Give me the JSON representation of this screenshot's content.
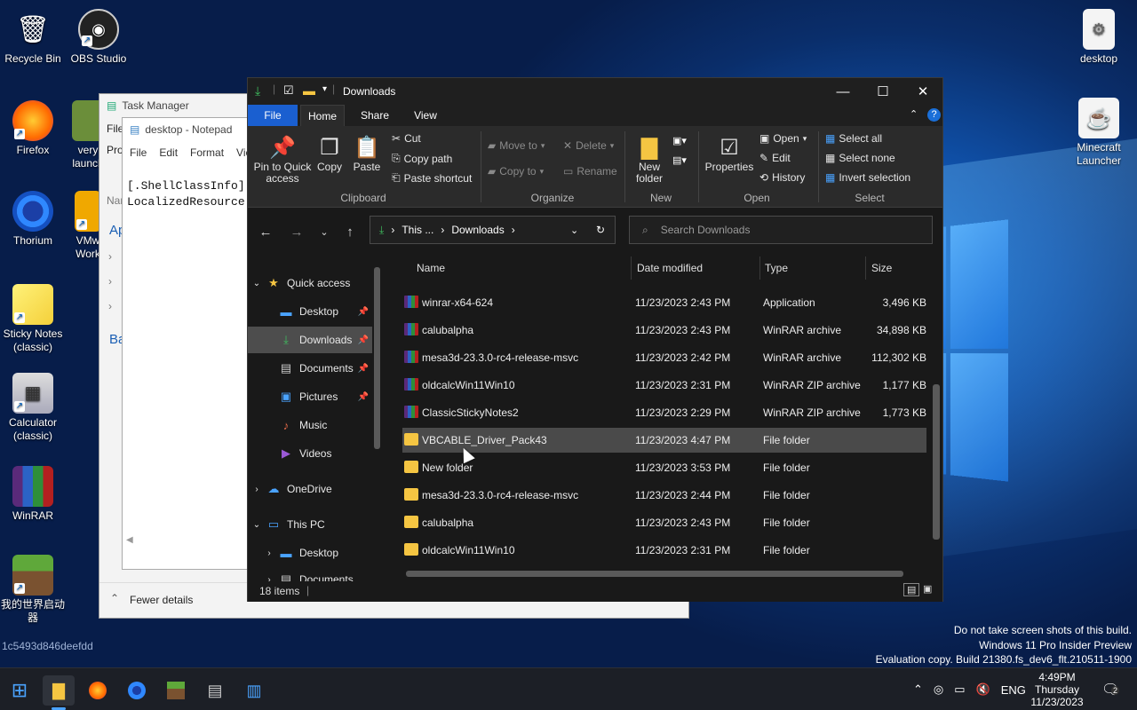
{
  "desktop": {
    "icons_left": [
      {
        "label": "Recycle Bin",
        "icon": "recycle-bin-icon"
      },
      {
        "label": "OBS Studio",
        "icon": "obs-icon"
      },
      {
        "label": "Firefox",
        "icon": "firefox-icon"
      },
      {
        "label": "very launch",
        "icon": "minecraft-launcher-icon"
      },
      {
        "label": "Thorium",
        "icon": "thorium-icon"
      },
      {
        "label": "VMw Work",
        "icon": "vmware-icon"
      },
      {
        "label": "Sticky Notes (classic)",
        "icon": "sticky-notes-icon"
      },
      {
        "label": "Calculator (classic)",
        "icon": "calculator-icon"
      },
      {
        "label": "WinRAR",
        "icon": "winrar-icon"
      },
      {
        "label": "我的世界启动器",
        "icon": "minecraft-grass-icon"
      }
    ],
    "icons_right": [
      {
        "label": "desktop",
        "icon": "settings-file-icon"
      },
      {
        "label": "Minecraft Launcher",
        "icon": "java-icon"
      }
    ],
    "hash_text": "1c5493d846deefdd",
    "watermark": [
      "Do not take screen shots of this build.",
      "Windows 11 Pro Insider Preview",
      "Evaluation copy. Build 21380.fs_dev6_flt.210511-1900"
    ]
  },
  "task_manager": {
    "title": "Task Manager",
    "menu_file": "File",
    "menu_pro": "Pro",
    "name_col": "Nar",
    "app_heading": "Ap",
    "bg_heading": "Ba",
    "fewer_details": "Fewer details"
  },
  "notepad": {
    "title": "desktop - Notepad",
    "menu": [
      "File",
      "Edit",
      "Format",
      "Vie"
    ],
    "lines": [
      "[.ShellClassInfo]",
      "LocalizedResource"
    ]
  },
  "explorer": {
    "title": "Downloads",
    "tabs": [
      "File",
      "Home",
      "Share",
      "View"
    ],
    "ribbon": {
      "pin": "Pin to Quick access",
      "copy": "Copy",
      "paste": "Paste",
      "cut": "Cut",
      "copy_path": "Copy path",
      "paste_shortcut": "Paste shortcut",
      "move_to": "Move to",
      "copy_to": "Copy to",
      "delete": "Delete",
      "rename": "Rename",
      "new_folder": "New folder",
      "properties": "Properties",
      "open": "Open",
      "edit": "Edit",
      "history": "History",
      "select_all": "Select all",
      "select_none": "Select none",
      "invert_selection": "Invert selection",
      "groups": {
        "clipboard": "Clipboard",
        "organize": "Organize",
        "new": "New",
        "open": "Open",
        "select": "Select"
      }
    },
    "address": {
      "crumb1": "This ...",
      "crumb2": "Downloads"
    },
    "search_placeholder": "Search Downloads",
    "nav": {
      "quick_access": "Quick access",
      "desktop": "Desktop",
      "downloads": "Downloads",
      "documents": "Documents",
      "pictures": "Pictures",
      "music": "Music",
      "videos": "Videos",
      "onedrive": "OneDrive",
      "this_pc": "This PC",
      "pc_desktop": "Desktop",
      "pc_documents": "Documents"
    },
    "columns": {
      "name": "Name",
      "date": "Date modified",
      "type": "Type",
      "size": "Size"
    },
    "files": [
      {
        "name": "winrar-x64-624",
        "date": "11/23/2023 2:43 PM",
        "type": "Application",
        "size": "3,496 KB",
        "kind": "rar"
      },
      {
        "name": "calubalpha",
        "date": "11/23/2023 2:43 PM",
        "type": "WinRAR archive",
        "size": "34,898 KB",
        "kind": "rar"
      },
      {
        "name": "mesa3d-23.3.0-rc4-release-msvc",
        "date": "11/23/2023 2:42 PM",
        "type": "WinRAR archive",
        "size": "112,302 KB",
        "kind": "rar"
      },
      {
        "name": "oldcalcWin11Win10",
        "date": "11/23/2023 2:31 PM",
        "type": "WinRAR ZIP archive",
        "size": "1,177 KB",
        "kind": "rar"
      },
      {
        "name": "ClassicStickyNotes2",
        "date": "11/23/2023 2:29 PM",
        "type": "WinRAR ZIP archive",
        "size": "1,773 KB",
        "kind": "rar"
      },
      {
        "name": "VBCABLE_Driver_Pack43",
        "date": "11/23/2023 4:47 PM",
        "type": "File folder",
        "size": "",
        "kind": "folder"
      },
      {
        "name": "New folder",
        "date": "11/23/2023 3:53 PM",
        "type": "File folder",
        "size": "",
        "kind": "folder"
      },
      {
        "name": "mesa3d-23.3.0-rc4-release-msvc",
        "date": "11/23/2023 2:44 PM",
        "type": "File folder",
        "size": "",
        "kind": "folder"
      },
      {
        "name": "calubalpha",
        "date": "11/23/2023 2:43 PM",
        "type": "File folder",
        "size": "",
        "kind": "folder"
      },
      {
        "name": "oldcalcWin11Win10",
        "date": "11/23/2023 2:31 PM",
        "type": "File folder",
        "size": "",
        "kind": "folder"
      }
    ],
    "status": "18 items"
  },
  "taskbar": {
    "lang": "ENG",
    "time": "4:49PM",
    "day": "Thursday",
    "date": "11/23/2023",
    "notif_count": "2"
  }
}
